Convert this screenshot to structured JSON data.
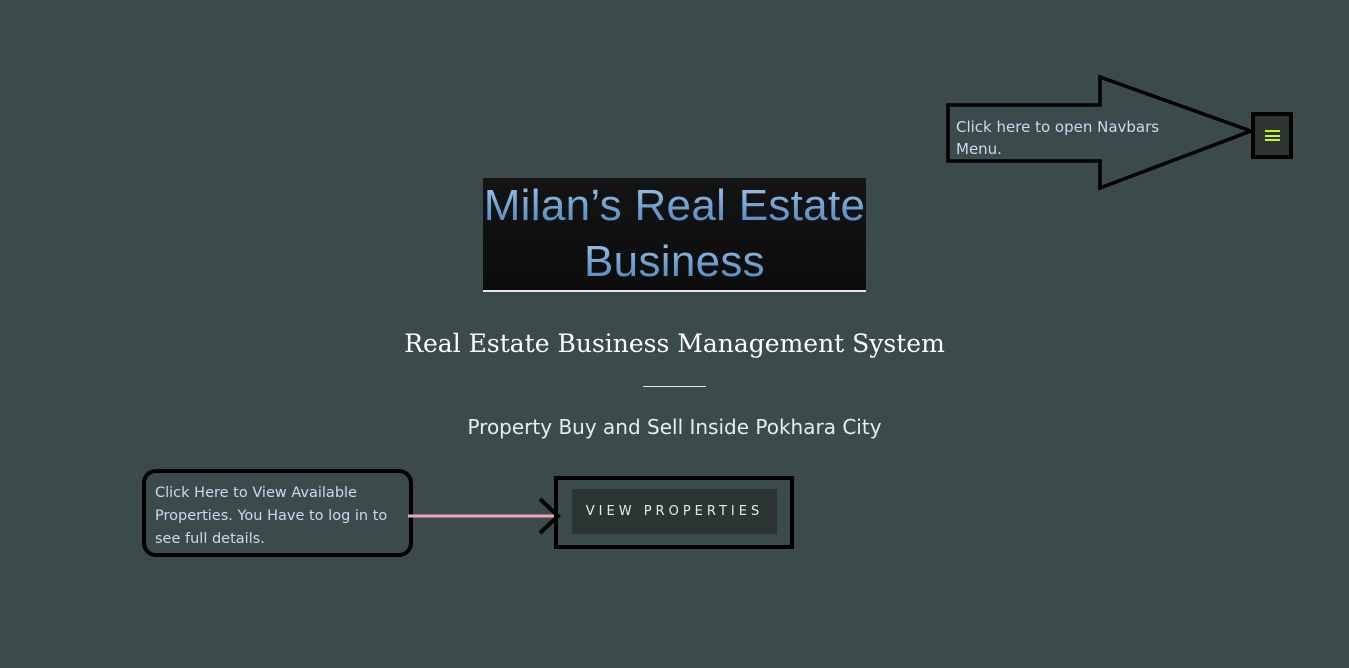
{
  "colors": {
    "page_background": "#3b4a4a",
    "button_background": "#2c3434",
    "logo_text": "#6c9ed0",
    "hamburger": "#c9f530",
    "callout_text": "#cfd8ee",
    "connector": "#f4a6b9"
  },
  "navbar_callout": {
    "text": "Click here to open Navbars Menu.",
    "toggle_icon": "hamburger-menu-icon"
  },
  "logo": {
    "line1": "Milan’s Real Estate",
    "line2": "Business"
  },
  "hero": {
    "title": "Real Estate Business Management System",
    "subtitle": "Property Buy and Sell Inside Pokhara City"
  },
  "cta": {
    "button_label": "VIEW PROPERTIES"
  },
  "properties_callout": {
    "text": "Click Here to View Available Properties. You Have to log in to see full details."
  }
}
